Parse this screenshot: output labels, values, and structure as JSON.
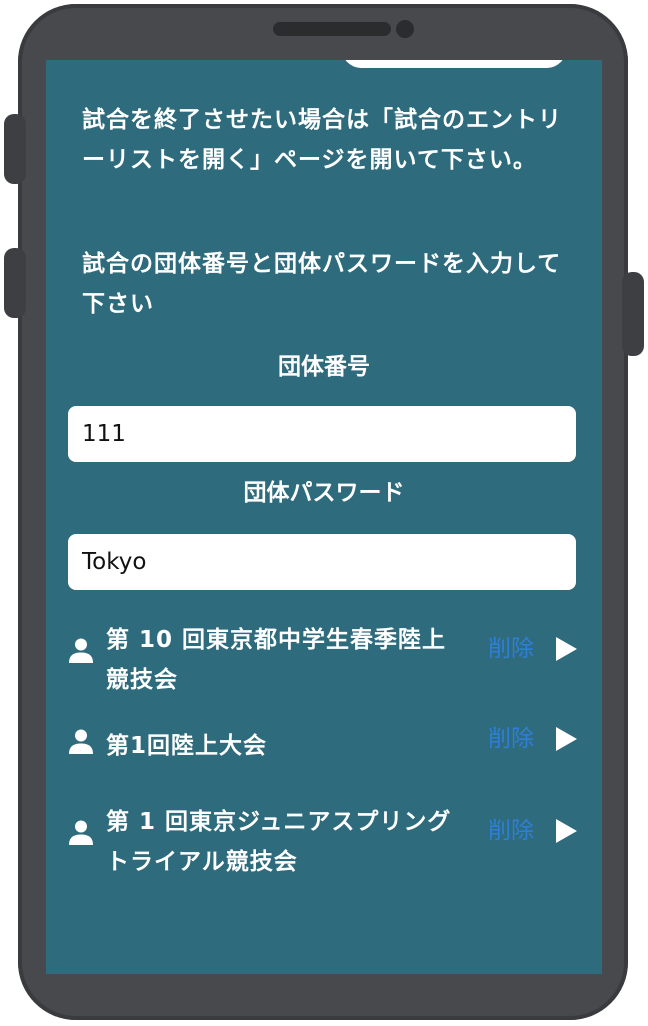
{
  "instructions": {
    "end_match": "試合を終了させたい場合は「試合のエントリーリストを開く」ページを開いて下さい。",
    "enter_credentials": "試合の団体番号と団体パスワードを入力して下さい"
  },
  "form": {
    "group_number": {
      "label": "団体番号",
      "value": "111"
    },
    "group_password": {
      "label": "団体パスワード",
      "value": "Tokyo"
    }
  },
  "matches": [
    {
      "title": "第 10 回東京都中学生春季陸上競技会",
      "delete_label": "削除",
      "icon": "user-icon"
    },
    {
      "title": "第1回陸上大会",
      "delete_label": "削除",
      "icon": "user-icon"
    },
    {
      "title": "第 1 回東京ジュニアスプリングトライアル競技会",
      "delete_label": "削除",
      "icon": "user-icon"
    }
  ],
  "colors": {
    "screen_background": "#2e6b7d",
    "delete_link": "#2f7fd6",
    "phone_frame": "#48494c"
  }
}
